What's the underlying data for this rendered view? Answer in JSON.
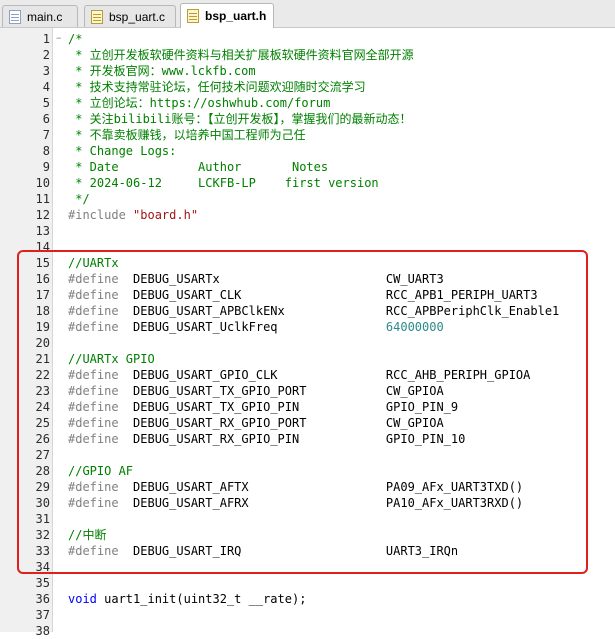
{
  "tabs": [
    {
      "label": "main.c",
      "kind": "c",
      "active": false
    },
    {
      "label": "bsp_uart.c",
      "kind": "c",
      "active": false
    },
    {
      "label": "bsp_uart.h",
      "kind": "h",
      "active": true
    }
  ],
  "highlight_color": "#e0201b",
  "lines": [
    {
      "n": "1",
      "fold": "−",
      "cls": "comment",
      "text": "/*"
    },
    {
      "n": "2",
      "fold": "",
      "cls": "comment",
      "text": " * 立创开发板软硬件资料与相关扩展板软硬件资料官网全部开源"
    },
    {
      "n": "3",
      "fold": "",
      "cls": "comment",
      "text": " * 开发板官网：www.lckfb.com"
    },
    {
      "n": "4",
      "fold": "",
      "cls": "comment",
      "text": " * 技术支持常驻论坛，任何技术问题欢迎随时交流学习"
    },
    {
      "n": "5",
      "fold": "",
      "cls": "comment",
      "text": " * 立创论坛：https://oshwhub.com/forum"
    },
    {
      "n": "6",
      "fold": "",
      "cls": "comment",
      "text": " * 关注bilibili账号：【立创开发板】，掌握我们的最新动态！"
    },
    {
      "n": "7",
      "fold": "",
      "cls": "comment",
      "text": " * 不靠卖板赚钱，以培养中国工程师为己任"
    },
    {
      "n": "8",
      "fold": "",
      "cls": "comment",
      "text": " * Change Logs:"
    },
    {
      "n": "9",
      "fold": "",
      "cls": "comment",
      "text": " * Date           Author       Notes"
    },
    {
      "n": "10",
      "fold": "",
      "cls": "comment",
      "text": " * 2024-06-12     LCKFB-LP    first version"
    },
    {
      "n": "11",
      "fold": "",
      "cls": "comment",
      "text": " */"
    },
    {
      "n": "12",
      "fold": "",
      "parts": [
        {
          "cls": "pp",
          "text": "#include "
        },
        {
          "cls": "str",
          "text": "\"board.h\""
        }
      ]
    },
    {
      "n": "13",
      "fold": "",
      "cls": "txt",
      "text": ""
    },
    {
      "n": "14",
      "fold": "",
      "cls": "txt",
      "text": ""
    },
    {
      "n": "15",
      "fold": "",
      "cls": "comment",
      "text": "//UARTx"
    },
    {
      "n": "16",
      "fold": "",
      "parts": [
        {
          "cls": "pp",
          "text": "#define"
        },
        {
          "cls": "txt",
          "text": "  DEBUG_USARTx                       CW_UART3"
        }
      ]
    },
    {
      "n": "17",
      "fold": "",
      "parts": [
        {
          "cls": "pp",
          "text": "#define"
        },
        {
          "cls": "txt",
          "text": "  DEBUG_USART_CLK                    RCC_APB1_PERIPH_UART3"
        }
      ]
    },
    {
      "n": "18",
      "fold": "",
      "parts": [
        {
          "cls": "pp",
          "text": "#define"
        },
        {
          "cls": "txt",
          "text": "  DEBUG_USART_APBClkENx              RCC_APBPeriphClk_Enable1"
        }
      ]
    },
    {
      "n": "19",
      "fold": "",
      "parts": [
        {
          "cls": "pp",
          "text": "#define"
        },
        {
          "cls": "txt",
          "text": "  DEBUG_USART_UclkFreq               "
        },
        {
          "cls": "num",
          "text": "64000000"
        }
      ]
    },
    {
      "n": "20",
      "fold": "",
      "cls": "txt",
      "text": ""
    },
    {
      "n": "21",
      "fold": "",
      "cls": "comment",
      "text": "//UARTx GPIO"
    },
    {
      "n": "22",
      "fold": "",
      "parts": [
        {
          "cls": "pp",
          "text": "#define"
        },
        {
          "cls": "txt",
          "text": "  DEBUG_USART_GPIO_CLK               RCC_AHB_PERIPH_GPIOA"
        }
      ]
    },
    {
      "n": "23",
      "fold": "",
      "parts": [
        {
          "cls": "pp",
          "text": "#define"
        },
        {
          "cls": "txt",
          "text": "  DEBUG_USART_TX_GPIO_PORT           CW_GPIOA"
        }
      ]
    },
    {
      "n": "24",
      "fold": "",
      "parts": [
        {
          "cls": "pp",
          "text": "#define"
        },
        {
          "cls": "txt",
          "text": "  DEBUG_USART_TX_GPIO_PIN            GPIO_PIN_9"
        }
      ]
    },
    {
      "n": "25",
      "fold": "",
      "parts": [
        {
          "cls": "pp",
          "text": "#define"
        },
        {
          "cls": "txt",
          "text": "  DEBUG_USART_RX_GPIO_PORT           CW_GPIOA"
        }
      ]
    },
    {
      "n": "26",
      "fold": "",
      "parts": [
        {
          "cls": "pp",
          "text": "#define"
        },
        {
          "cls": "txt",
          "text": "  DEBUG_USART_RX_GPIO_PIN            GPIO_PIN_10"
        }
      ]
    },
    {
      "n": "27",
      "fold": "",
      "cls": "txt",
      "text": ""
    },
    {
      "n": "28",
      "fold": "",
      "cls": "comment",
      "text": "//GPIO AF"
    },
    {
      "n": "29",
      "fold": "",
      "parts": [
        {
          "cls": "pp",
          "text": "#define"
        },
        {
          "cls": "txt",
          "text": "  DEBUG_USART_AFTX                   PA09_AFx_UART3TXD()"
        }
      ]
    },
    {
      "n": "30",
      "fold": "",
      "parts": [
        {
          "cls": "pp",
          "text": "#define"
        },
        {
          "cls": "txt",
          "text": "  DEBUG_USART_AFRX                   PA10_AFx_UART3RXD()"
        }
      ]
    },
    {
      "n": "31",
      "fold": "",
      "cls": "txt",
      "text": ""
    },
    {
      "n": "32",
      "fold": "",
      "cls": "comment",
      "text": "//中断"
    },
    {
      "n": "33",
      "fold": "",
      "parts": [
        {
          "cls": "pp",
          "text": "#define"
        },
        {
          "cls": "txt",
          "text": "  DEBUG_USART_IRQ                    UART3_IRQn"
        }
      ]
    },
    {
      "n": "34",
      "fold": "",
      "cls": "txt",
      "text": ""
    },
    {
      "n": "35",
      "fold": "",
      "cls": "txt",
      "text": ""
    },
    {
      "n": "36",
      "fold": "",
      "parts": [
        {
          "cls": "kw",
          "text": "void"
        },
        {
          "cls": "txt",
          "text": " uart1_init(uint32_t __rate);"
        }
      ]
    },
    {
      "n": "37",
      "fold": "",
      "cls": "txt",
      "text": ""
    },
    {
      "n": "38",
      "fold": "",
      "cls": "txt",
      "text": ""
    }
  ]
}
